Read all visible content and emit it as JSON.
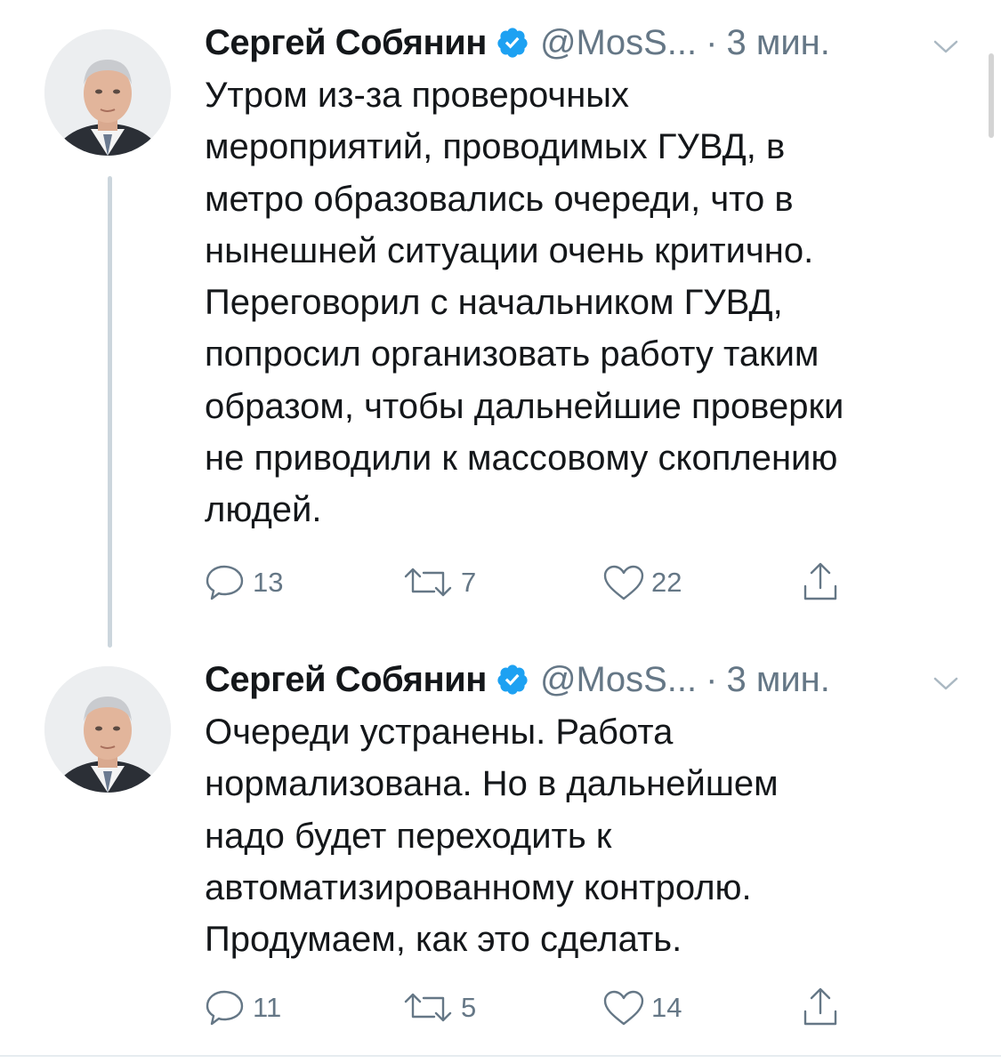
{
  "colors": {
    "verified_badge": "#1da1f2",
    "secondary_text": "#657786",
    "primary_text": "#14171a",
    "thread_line": "#ccd6dd"
  },
  "tweets": [
    {
      "author": {
        "name": "Сергей Собянин",
        "handle": "@MosS...",
        "verified": true,
        "avatar_icon": "avatar"
      },
      "separator": "·",
      "time": "3 мин.",
      "text_lines": [
        "Утром из-за проверочных",
        "мероприятий, проводимых ГУВД, в",
        "метро образовались очереди, что в",
        "нынешней ситуации очень критично.",
        "Переговорил с начальником ГУВД,",
        "попросил организовать работу таким",
        "образом, чтобы дальнейшие проверки",
        "не приводили к массовому скоплению",
        "людей."
      ],
      "actions": {
        "reply_count": "13",
        "retweet_count": "7",
        "like_count": "22"
      }
    },
    {
      "author": {
        "name": "Сергей Собянин",
        "handle": "@MosS...",
        "verified": true,
        "avatar_icon": "avatar"
      },
      "separator": "·",
      "time": "3 мин.",
      "text_lines": [
        "Очереди устранены. Работа",
        "нормализована. Но в дальнейшем",
        "надо будет переходить к",
        "автоматизированному контролю.",
        "Продумаем, как это сделать."
      ],
      "actions": {
        "reply_count": "11",
        "retweet_count": "5",
        "like_count": "14"
      }
    }
  ]
}
